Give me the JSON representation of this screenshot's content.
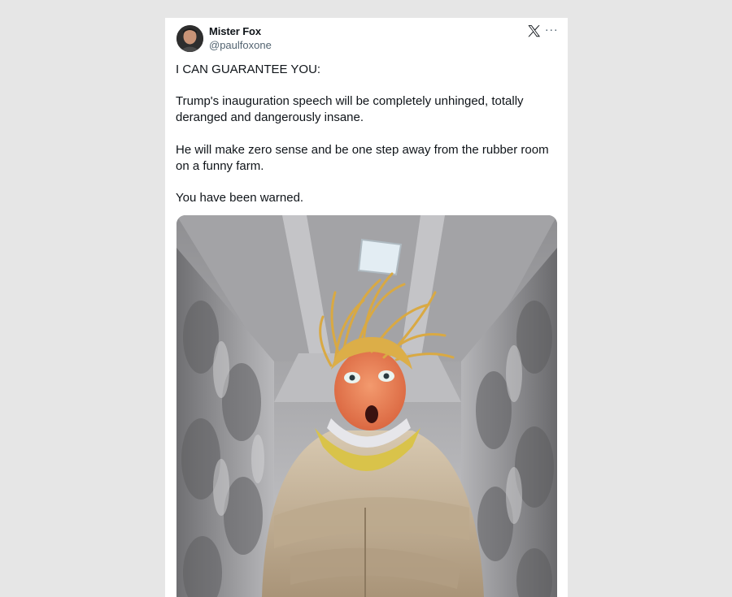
{
  "tweet": {
    "author_name": "Mister Fox",
    "author_handle": "@paulfoxone",
    "lines": [
      "I CAN GUARANTEE YOU:",
      "Trump's inauguration speech will be completely unhinged, totally deranged and dangerously insane.",
      "He will make zero sense and be one step away from the rubber room on a funny farm.",
      "You have been warned."
    ]
  },
  "icons": {
    "avatar": "avatar-photo",
    "platform": "x-logo-icon",
    "more": "more-options-icon",
    "more_glyph": "···"
  },
  "media": {
    "kind": "photo",
    "subject": "caricature in straitjacket in padded cell"
  },
  "colors": {
    "page_bg": "#e6e6e6",
    "card_bg": "#ffffff",
    "text_primary": "#0f1419",
    "text_secondary": "#536471"
  }
}
